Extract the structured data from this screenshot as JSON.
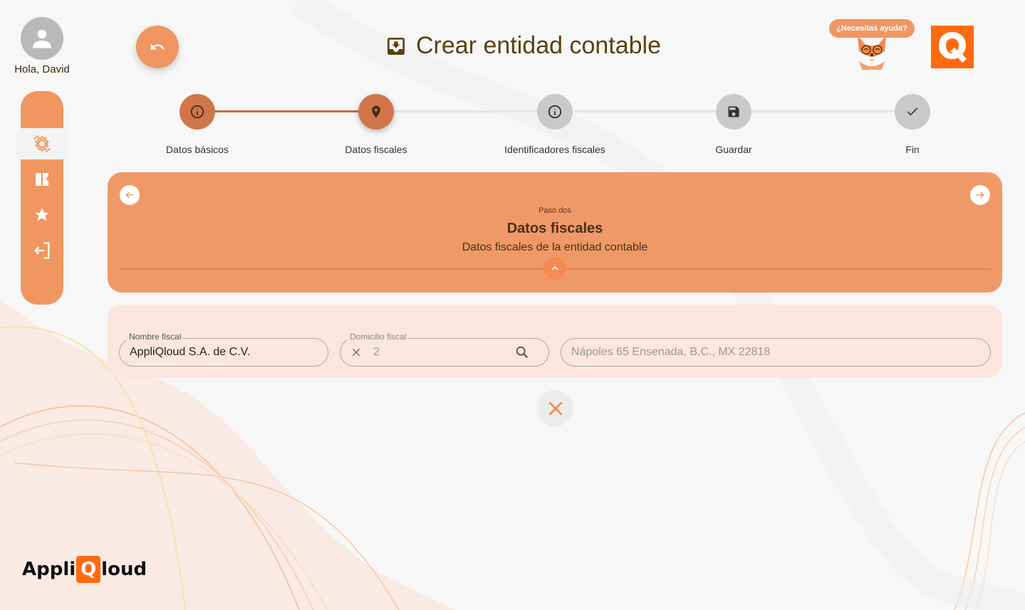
{
  "user": {
    "greeting": "Hola, David"
  },
  "sidebar": {
    "items": [
      {
        "icon": "gear-sync-icon",
        "active": true
      },
      {
        "icon": "ticket-icon",
        "active": false
      },
      {
        "icon": "star-icon",
        "active": false
      },
      {
        "icon": "logout-icon",
        "active": false
      }
    ]
  },
  "header": {
    "title": "Crear entidad contable",
    "title_icon": "inbox-download-icon",
    "help_label": "¿Necesitas ayuda?",
    "brand_letter": "Q"
  },
  "stepper": {
    "steps": [
      {
        "label": "Datos básicos",
        "icon": "info-icon",
        "status": "done"
      },
      {
        "label": "Datos fiscales",
        "icon": "location-pin-icon",
        "status": "current"
      },
      {
        "label": "Identificadores fiscales",
        "icon": "info-icon",
        "status": "todo"
      },
      {
        "label": "Guardar",
        "icon": "save-icon",
        "status": "todo"
      },
      {
        "label": "Fin",
        "icon": "check-icon",
        "status": "todo"
      }
    ]
  },
  "step_card": {
    "kicker": "Paso dos",
    "title": "Datos fiscales",
    "description": "Datos fiscales de la entidad contable"
  },
  "form": {
    "nombre_fiscal": {
      "label": "Nombre fiscal",
      "value": "AppliQloud S.A. de C.V."
    },
    "domicilio_fiscal": {
      "label": "Domicilio fiscal",
      "value": "2"
    },
    "direccion": {
      "value": "Nápoles 65 Ensenada, B.C., MX 22818"
    }
  },
  "footer": {
    "logo_left": "Appli",
    "logo_q": "Q",
    "logo_right": "loud"
  },
  "colors": {
    "accent": "#f09660",
    "accent_dark": "#d0764a",
    "form_bg": "#fae6dc",
    "brand": "#ff6a10",
    "title_text": "#5a4210"
  }
}
